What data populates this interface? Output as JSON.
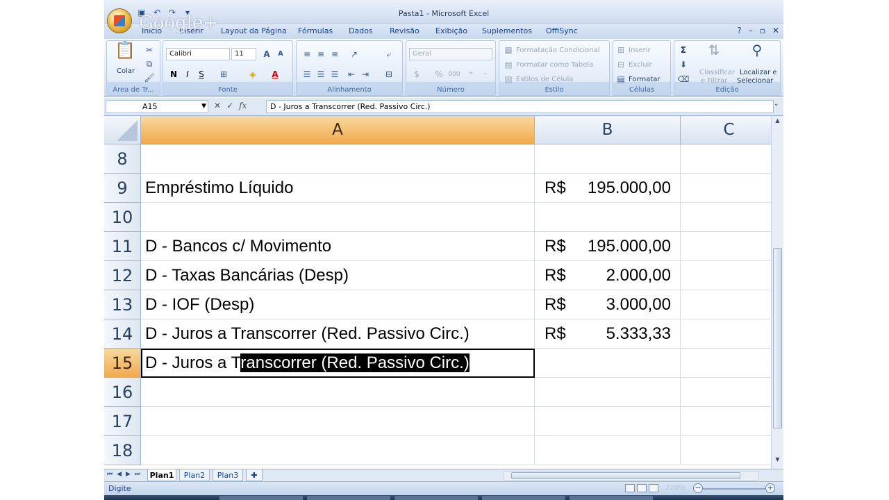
{
  "window": {
    "title": "Pasta1 - Microsoft Excel",
    "watermark": "Google+"
  },
  "menu_tabs": [
    "Início",
    "Inserir",
    "Layout da Página",
    "Fórmulas",
    "Dados",
    "Revisão",
    "Exibição",
    "Suplementos",
    "OffiSync"
  ],
  "ribbon": {
    "clipboard": {
      "paste_label": "Colar",
      "group_label": "Área de Tr..."
    },
    "font": {
      "family": "Calibri",
      "size": "11",
      "bold": "N",
      "italic": "I",
      "underline": "S",
      "grow": "A",
      "shrink": "A",
      "color_letter": "A",
      "group_label": "Fonte"
    },
    "alignment": {
      "group_label": "Alinhamento"
    },
    "number": {
      "format": "Geral",
      "percent": "%",
      "thousands": "000",
      "group_label": "Número"
    },
    "styles": {
      "conditional": "Formatação Condicional",
      "as_table": "Formatar como Tabela",
      "cell_styles": "Estilos de Célula",
      "group_label": "Estilo"
    },
    "cells": {
      "insert": "Inserir",
      "delete": "Excluir",
      "format": "Formatar",
      "group_label": "Células"
    },
    "editing": {
      "sum": "Σ",
      "sort_filter_1": "Classificar",
      "sort_filter_2": "e Filtrar",
      "find_1": "Localizar e",
      "find_2": "Selecionar",
      "group_label": "Edição"
    }
  },
  "formula_bar": {
    "name_box": "A15",
    "fx": "fx",
    "formula": "D - Juros a Transcorrer (Red. Passivo Circ.)"
  },
  "columns": [
    "A",
    "B",
    "C"
  ],
  "rows": [
    {
      "num": "8",
      "a": "",
      "cur": "",
      "val": ""
    },
    {
      "num": "9",
      "a": "Empréstimo Líquido",
      "cur": "R$",
      "val": "195.000,00"
    },
    {
      "num": "10",
      "a": "",
      "cur": "",
      "val": ""
    },
    {
      "num": "11",
      "a": "D - Bancos c/ Movimento",
      "cur": "R$",
      "val": "195.000,00"
    },
    {
      "num": "12",
      "a": "D - Taxas Bancárias (Desp)",
      "cur": "R$",
      "val": "2.000,00"
    },
    {
      "num": "13",
      "a": "D - IOF (Desp)",
      "cur": "R$",
      "val": "3.000,00"
    },
    {
      "num": "14",
      "a": "D - Juros a Transcorrer (Red. Passivo Circ.)",
      "cur": "R$",
      "val": "5.333,33"
    },
    {
      "num": "15",
      "a_plain": "D - Juros a T",
      "a_selected": "ranscorrer (Red. Passivo Circ.)",
      "cur": "",
      "val": ""
    },
    {
      "num": "16",
      "a": "",
      "cur": "",
      "val": ""
    },
    {
      "num": "17",
      "a": "",
      "cur": "",
      "val": ""
    },
    {
      "num": "18",
      "a": "",
      "cur": "",
      "val": ""
    }
  ],
  "sheets": [
    "Plan1",
    "Plan2",
    "Plan3"
  ],
  "status": {
    "mode": "Digite",
    "zoom": "220%"
  },
  "colors": {
    "selected_header": "#f1a94d",
    "ribbon_bg": "#dde8f6",
    "accent": "#15428b"
  }
}
